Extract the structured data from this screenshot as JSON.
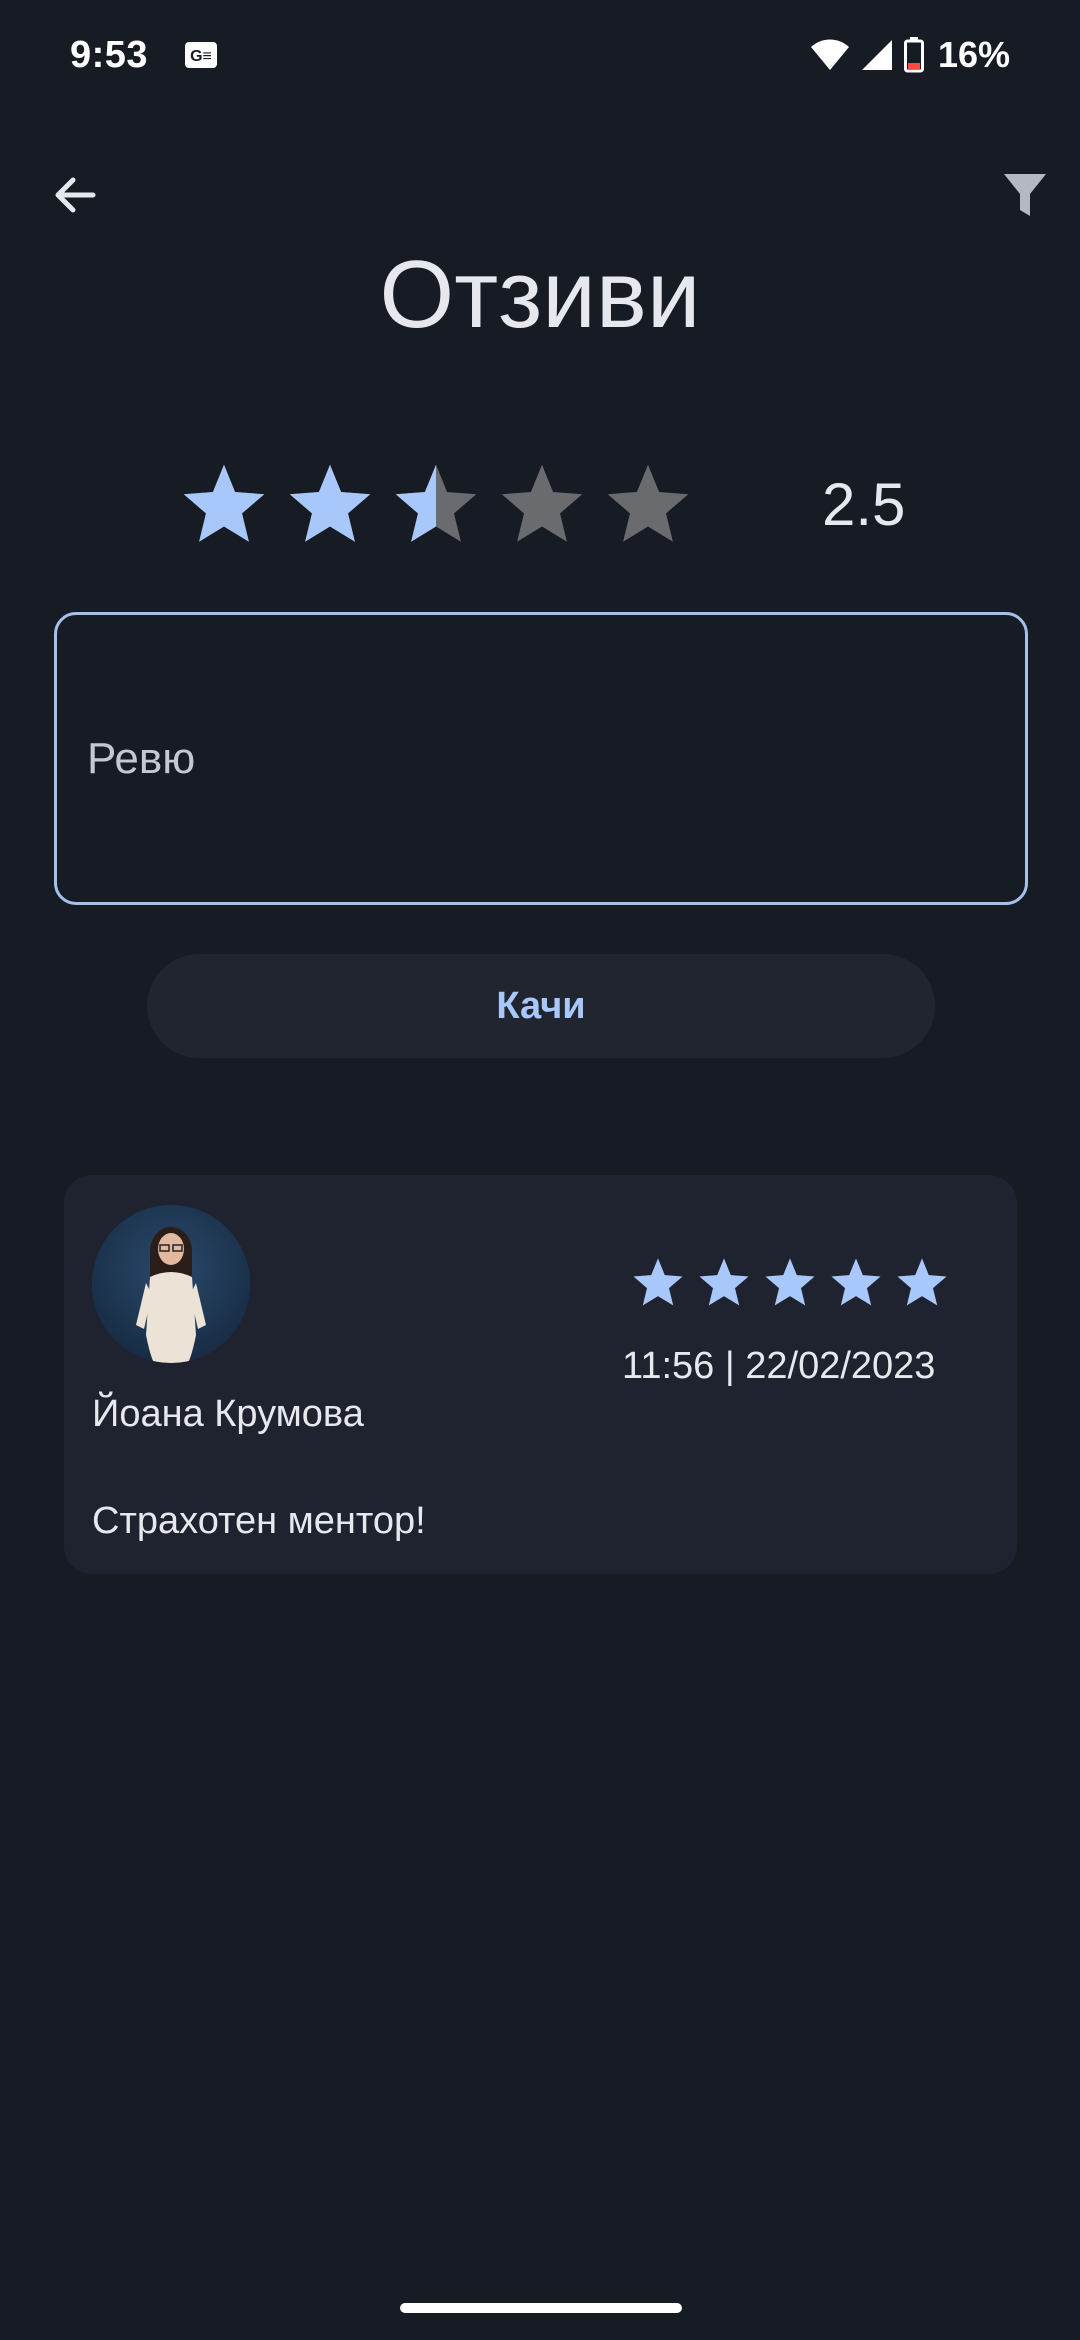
{
  "status_bar": {
    "time": "9:53",
    "battery": "16%",
    "icons": [
      "gs-notification-icon",
      "wifi-icon",
      "cell-signal-icon",
      "battery-icon"
    ]
  },
  "header": {
    "title": "Отзиви",
    "back_icon": "arrow-back-icon",
    "filter_icon": "filter-icon"
  },
  "rating": {
    "value": "2.5",
    "max": 5,
    "score": 2.5
  },
  "review_input": {
    "placeholder": "Ревю",
    "value": ""
  },
  "upload_button": {
    "label": "Качи"
  },
  "reviews": [
    {
      "author": "Йоана Крумова",
      "stars": 5,
      "datetime": "11:56 | 22/02/2023",
      "text": "Страхотен ментор!"
    }
  ],
  "colors": {
    "background": "#161b24",
    "card": "#1f2330",
    "accent": "#a8c7fa",
    "star_filled": "#a8c7fa",
    "star_empty": "#6a6b6e",
    "button_bg": "#21252f"
  }
}
